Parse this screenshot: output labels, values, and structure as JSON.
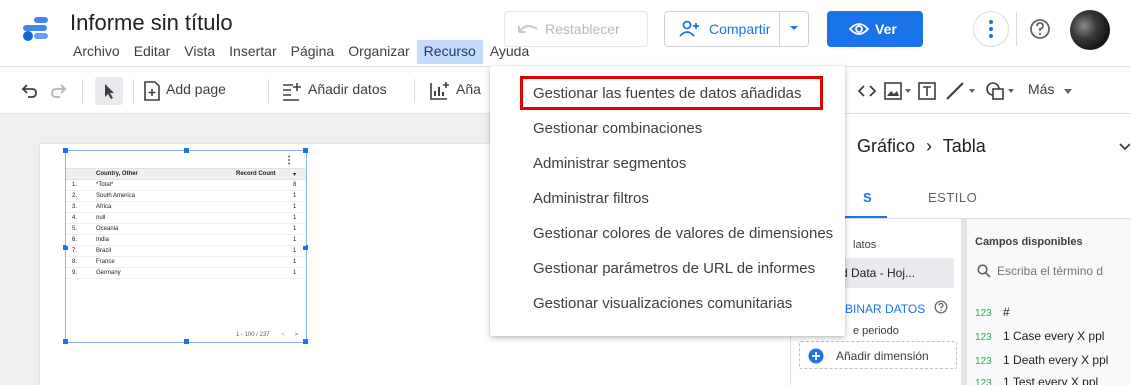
{
  "header": {
    "title": "Informe sin título",
    "restablecer_label": "Restablecer",
    "compartir_label": "Compartir",
    "ver_label": "Ver"
  },
  "menubar": [
    "Archivo",
    "Editar",
    "Vista",
    "Insertar",
    "Página",
    "Organizar",
    "Recurso",
    "Ayuda"
  ],
  "toolbar": {
    "add_page": "Add page",
    "add_data": "Añadir datos",
    "add_chart_partial": "Aña",
    "more": "Más"
  },
  "dropdown": {
    "items": [
      "Gestionar las fuentes de datos añadidas",
      "Gestionar combinaciones",
      "Administrar segmentos",
      "Administrar filtros",
      "Gestionar colores de valores de dimensiones",
      "Gestionar parámetros de URL de informes",
      "Gestionar visualizaciones comunitarias"
    ]
  },
  "mini_table": {
    "col1": "Country, Other",
    "col2": "Record Count",
    "rows": [
      {
        "n": "1.",
        "name": "*Total*",
        "v": "8"
      },
      {
        "n": "2.",
        "name": "South America",
        "v": "1"
      },
      {
        "n": "3.",
        "name": "Africa",
        "v": "1"
      },
      {
        "n": "4.",
        "name": "null",
        "v": "1"
      },
      {
        "n": "5.",
        "name": "Oceania",
        "v": "1"
      },
      {
        "n": "6.",
        "name": "India",
        "v": "1"
      },
      {
        "n": "7.",
        "name": "Brazil",
        "v": "1"
      },
      {
        "n": "8.",
        "name": "France",
        "v": "1"
      },
      {
        "n": "9.",
        "name": "Germany",
        "v": "1"
      }
    ],
    "pagination": "1 - 100 / 237"
  },
  "panel": {
    "title": "Gráfico",
    "subtitle": "Tabla",
    "tab_data": "S",
    "tab_style": "ESTILO",
    "datasource_label": "latos",
    "datasource_value": "d Data - Hoj...",
    "blend_label": "BINAR DATOS",
    "period_label": "e periodo",
    "add_dimension": "Añadir dimensión",
    "available_fields": "Campos disponibles",
    "search_placeholder": "Escriba el término d",
    "fields": [
      {
        "num": "123",
        "label": "#"
      },
      {
        "num": "123",
        "label": "1 Case every X ppl"
      },
      {
        "num": "123",
        "label": "1 Death every X ppl"
      },
      {
        "num": "123",
        "label": "1 Test every X ppl"
      }
    ]
  },
  "colors": {
    "accent": "#1a73e8",
    "highlight_border": "#e00000",
    "menu_active": "#c6dafc"
  }
}
